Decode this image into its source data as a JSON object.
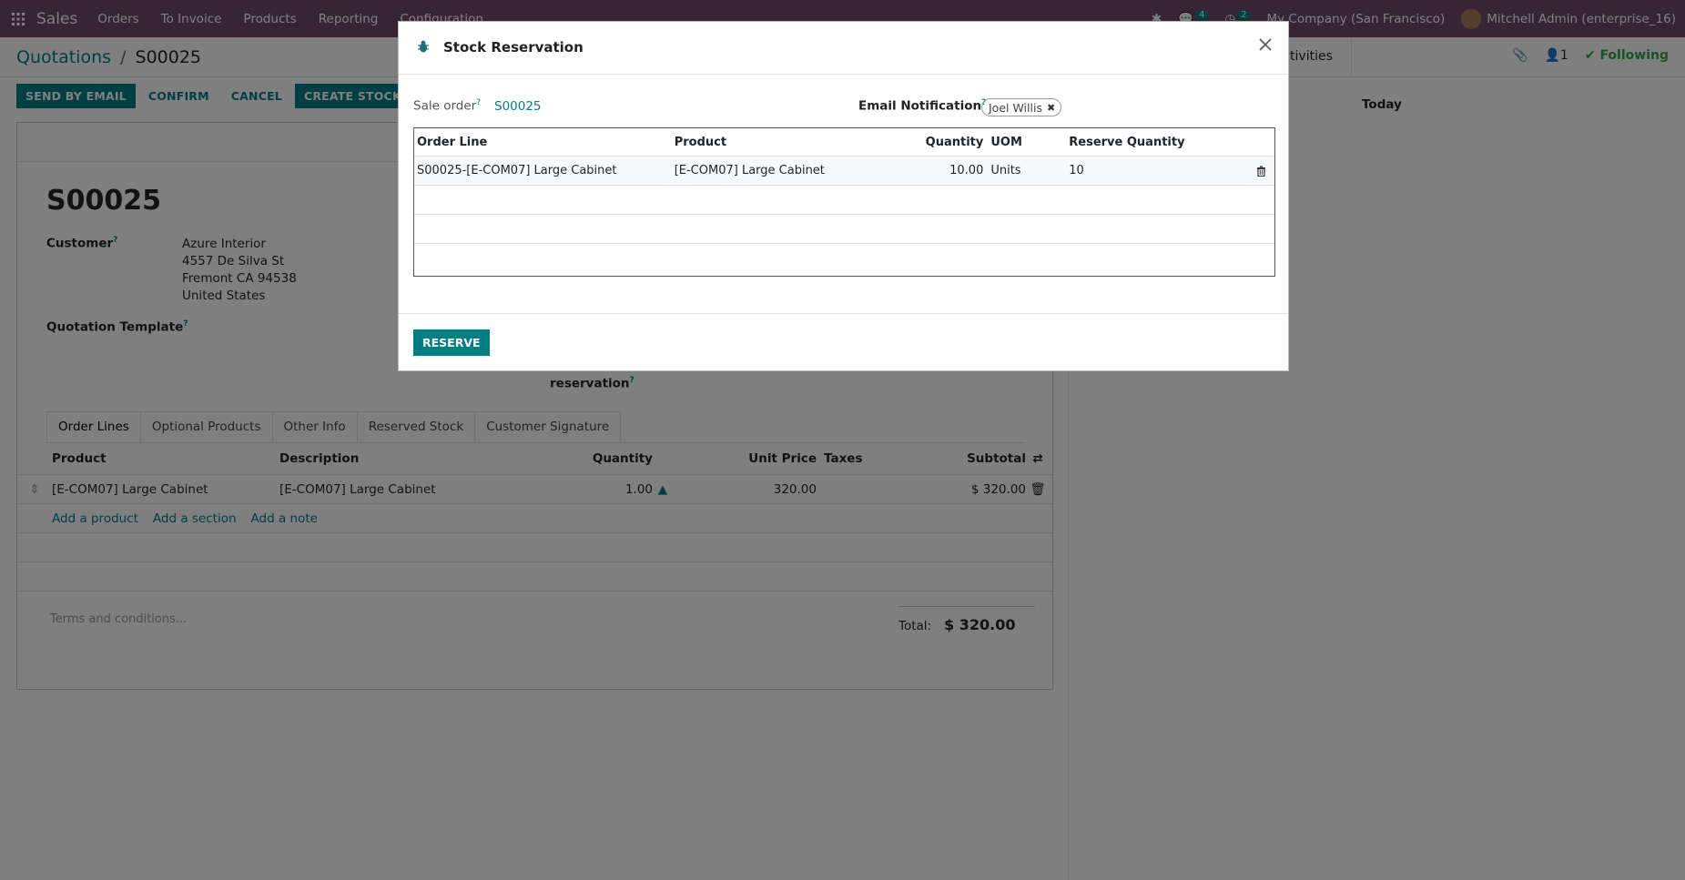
{
  "topbar": {
    "brand": "Sales",
    "menu": [
      "Orders",
      "To Invoice",
      "Products",
      "Reporting",
      "Configuration"
    ],
    "messages_count": "4",
    "activities_count": "2",
    "company": "My Company (San Francisco)",
    "user": "Mitchell Admin (enterprise_16)"
  },
  "breadcrumb": {
    "parent": "Quotations",
    "separator": "/",
    "current": "S00025"
  },
  "chatter": {
    "activities_tab": "Activities",
    "followers_count": "1",
    "following": "Following",
    "today": "Today"
  },
  "actions": {
    "send_email": "SEND BY EMAIL",
    "confirm": "CONFIRM",
    "cancel": "CANCEL",
    "create_reservation": "CREATE STOCK RESERV"
  },
  "form": {
    "name": "S00025",
    "customer_label": "Customer",
    "customer_address": [
      "Azure Interior",
      "4557 De Silva St",
      "Fremont CA 94538",
      "United States"
    ],
    "template_label": "Quotation Template",
    "reservation_label": "reservation",
    "tabs": [
      "Order Lines",
      "Optional Products",
      "Other Info",
      "Reserved Stock",
      "Customer Signature"
    ],
    "lines_columns": [
      "Product",
      "Description",
      "Quantity",
      "Unit Price",
      "Taxes",
      "Subtotal"
    ],
    "lines": [
      {
        "product": "[E-COM07] Large Cabinet",
        "description": "[E-COM07] Large Cabinet",
        "quantity": "1.00",
        "unit_price": "320.00",
        "taxes": "",
        "subtotal": "$ 320.00"
      }
    ],
    "add_links": [
      "Add a product",
      "Add a section",
      "Add a note"
    ],
    "terms_placeholder": "Terms and conditions...",
    "total_label": "Total:",
    "total_value": "$ 320.00"
  },
  "modal": {
    "title": "Stock Reservation",
    "sale_order_label": "Sale order",
    "sale_order_value": "S00025",
    "email_label": "Email Notification",
    "email_tag": "Joel Willis",
    "columns": [
      "Order Line",
      "Product",
      "Quantity",
      "UOM",
      "Reserve Quantity"
    ],
    "rows": [
      {
        "order_line": "S00025-[E-COM07] Large Cabinet",
        "product": "[E-COM07] Large Cabinet",
        "quantity": "10.00",
        "uom": "Units",
        "reserve_qty": "10"
      }
    ],
    "reserve_button": "RESERVE"
  },
  "colors": {
    "brand": "#714b67",
    "accent": "#017e84",
    "following": "#28a745"
  }
}
